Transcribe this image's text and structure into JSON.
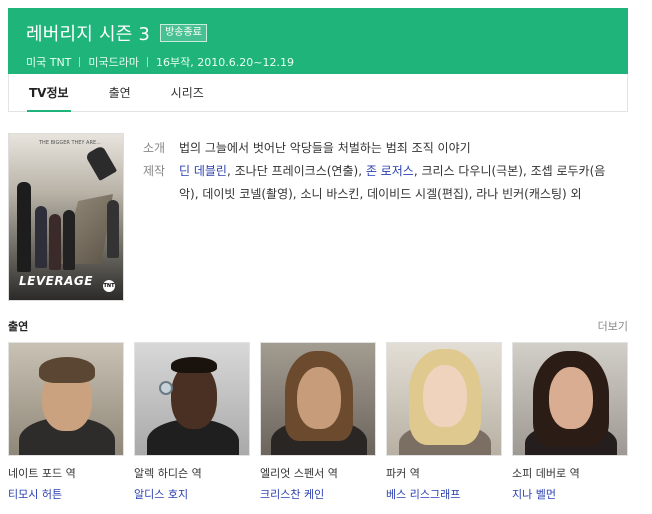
{
  "header": {
    "title": "레버리지 시즌 3",
    "badge": "방송종료",
    "meta": [
      "미국 TNT",
      "미국드라마",
      "16부작, 2010.6.20~12.19"
    ],
    "color": "#1fb47a"
  },
  "tabs": [
    {
      "label": "TV정보",
      "active": true
    },
    {
      "label": "출연",
      "active": false
    },
    {
      "label": "시리즈",
      "active": false
    }
  ],
  "poster": {
    "tagline": "THE BIGGER THEY ARE...",
    "logo": "LEVERAGE",
    "network": "TNT"
  },
  "info": {
    "summary_label": "소개",
    "summary": "법의 그늘에서 벗어난 악당들을 처벌하는 범죄 조직 이야기",
    "crew_label": "제작",
    "crew": [
      {
        "text": "딘 데블린",
        "link": true
      },
      {
        "text": ", 조나단 프레이크스(연출), ",
        "link": false
      },
      {
        "text": "존 로저스",
        "link": true
      },
      {
        "text": ", 크리스 다우니(극본), 조셉 로두카(음악), 데이빗 코넬(촬영), 소니 바스킨, 데이비드 시겔(편집), 라나 빈커(캐스팅) 외",
        "link": false
      }
    ]
  },
  "cast_section": {
    "title": "출연",
    "more": "더보기"
  },
  "cast": [
    {
      "role": "네이트 포드 역",
      "actor": "티모시 허튼"
    },
    {
      "role": "알렉 하디슨 역",
      "actor": "알디스 호지"
    },
    {
      "role": "엘리엇 스펜서 역",
      "actor": "크리스찬 케인"
    },
    {
      "role": "파커 역",
      "actor": "베스 리스그래프"
    },
    {
      "role": "소피 데버로 역",
      "actor": "지나 벨먼"
    }
  ]
}
